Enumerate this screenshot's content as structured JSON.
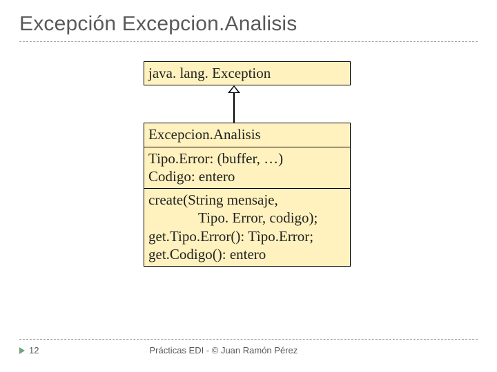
{
  "slide": {
    "title": "Excepción Excepcion.Analisis",
    "page_number": "12",
    "footer": "Prácticas EDI - © Juan Ramón Pérez"
  },
  "uml": {
    "parent": {
      "name": "java. lang. Exception"
    },
    "child": {
      "name": "Excepcion.Analisis",
      "attributes": [
        "Tipo.Error: (buffer,  …)",
        "Codigo: entero"
      ],
      "operations_lines": [
        "create(String mensaje,",
        "Tipo. Error, codigo);",
        "get.Tipo.Error(): Tìpo.Error;",
        "get.Codigo(): entero"
      ]
    }
  }
}
